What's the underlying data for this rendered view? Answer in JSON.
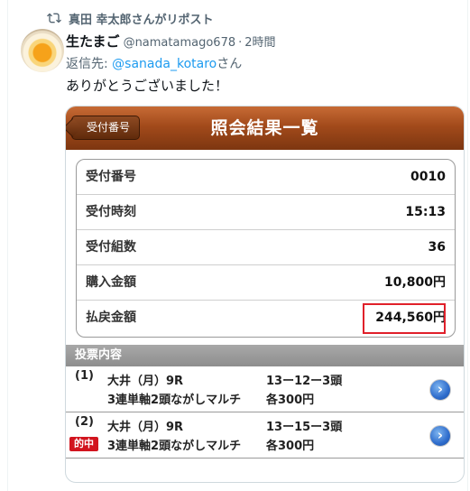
{
  "retweet": {
    "label": "真田 幸太郎さんがリポスト"
  },
  "author": {
    "name": "生たまご",
    "handle": "@namatamago678",
    "separator": "·",
    "time": "2時間"
  },
  "reply": {
    "prefix": "返信先: ",
    "mention": "@sanada_kotaro",
    "suffix": "さん"
  },
  "tweet": {
    "text": "ありがとうございました！"
  },
  "card": {
    "back_label": "受付番号",
    "title": "照会結果一覧",
    "summary": [
      {
        "label": "受付番号",
        "value": "0010"
      },
      {
        "label": "受付時刻",
        "value": "15:13"
      },
      {
        "label": "受付組数",
        "value": "36"
      },
      {
        "label": "購入金額",
        "value": "10,800円"
      },
      {
        "label": "払戻金額",
        "value": "244,560円"
      }
    ],
    "section_title": "投票内容",
    "tickets": [
      {
        "num": "(1)",
        "venue": "大井（月）9R",
        "combo": "13ー12ー3頭",
        "bet_type": "3連単軸2頭ながしマルチ",
        "amount": "各300円",
        "hit": ""
      },
      {
        "num": "(2)",
        "venue": "大井（月）9R",
        "combo": "13ー15ー3頭",
        "bet_type": "3連単軸2頭ながしマルチ",
        "amount": "各300円",
        "hit": "的中"
      }
    ]
  },
  "colors": {
    "header_brown": "#a24a1b",
    "highlight_red": "#e0202a",
    "hit_red": "#d2141e",
    "link_blue": "#1d9bf0",
    "go_button_blue": "#2e6ccc"
  },
  "icons": {
    "retweet": "retweet-icon",
    "go": "chevron-right-circle-icon"
  }
}
